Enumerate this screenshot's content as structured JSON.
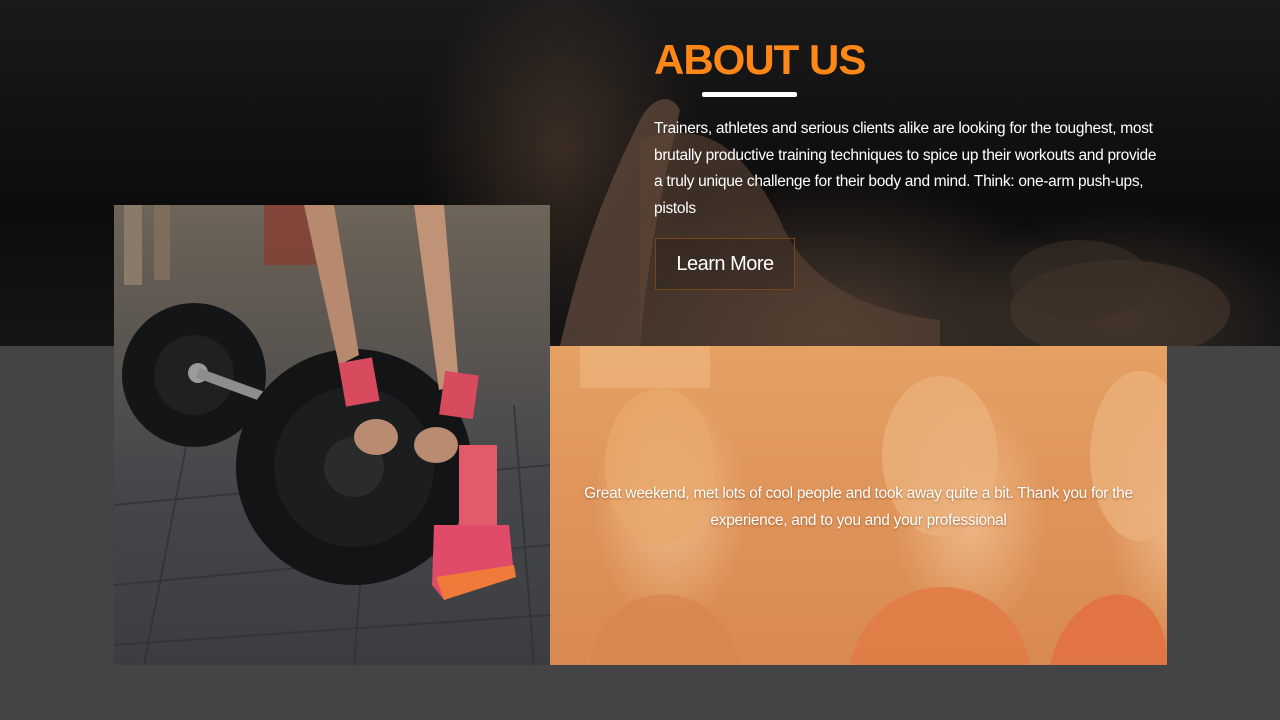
{
  "about": {
    "title": "ABOUT US",
    "description": "Trainers, athletes and serious clients alike are looking for the toughest, most brutally productive training techniques to spice up their workouts and provide a truly unique challenge for their body and mind. Think: one-arm push-ups, pistols",
    "button_label": "Learn More"
  },
  "testimonial": {
    "quote": "Great weekend, met lots of cool people and took away quite a bit. Thank you for the experience, and to you and your professional"
  },
  "colors": {
    "accent": "#ff8717",
    "page_background": "#444444",
    "hero_background": "#0c0c0c",
    "testimonial_overlay": "#e0955a"
  }
}
